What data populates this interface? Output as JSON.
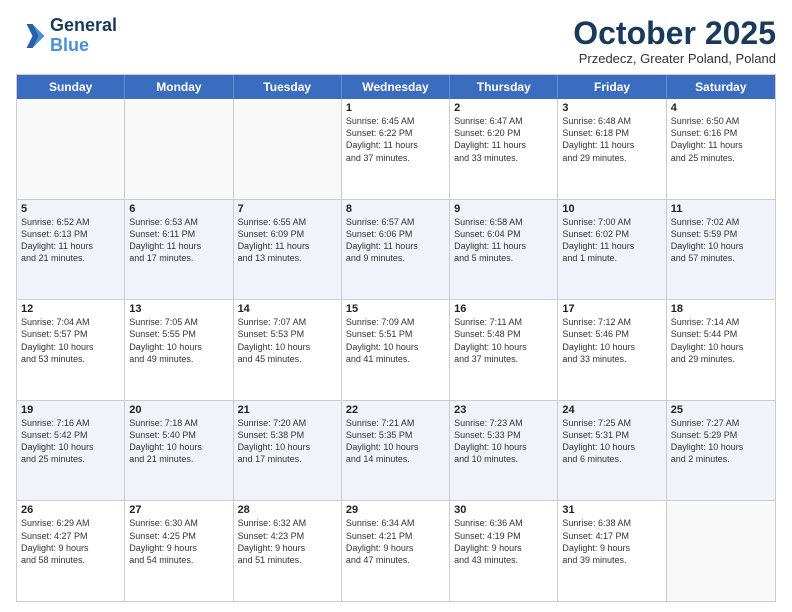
{
  "logo": {
    "line1": "General",
    "line2": "Blue"
  },
  "title": "October 2025",
  "subtitle": "Przedecz, Greater Poland, Poland",
  "header_days": [
    "Sunday",
    "Monday",
    "Tuesday",
    "Wednesday",
    "Thursday",
    "Friday",
    "Saturday"
  ],
  "weeks": [
    [
      {
        "day": "",
        "info": ""
      },
      {
        "day": "",
        "info": ""
      },
      {
        "day": "",
        "info": ""
      },
      {
        "day": "1",
        "info": "Sunrise: 6:45 AM\nSunset: 6:22 PM\nDaylight: 11 hours\nand 37 minutes."
      },
      {
        "day": "2",
        "info": "Sunrise: 6:47 AM\nSunset: 6:20 PM\nDaylight: 11 hours\nand 33 minutes."
      },
      {
        "day": "3",
        "info": "Sunrise: 6:48 AM\nSunset: 6:18 PM\nDaylight: 11 hours\nand 29 minutes."
      },
      {
        "day": "4",
        "info": "Sunrise: 6:50 AM\nSunset: 6:16 PM\nDaylight: 11 hours\nand 25 minutes."
      }
    ],
    [
      {
        "day": "5",
        "info": "Sunrise: 6:52 AM\nSunset: 6:13 PM\nDaylight: 11 hours\nand 21 minutes."
      },
      {
        "day": "6",
        "info": "Sunrise: 6:53 AM\nSunset: 6:11 PM\nDaylight: 11 hours\nand 17 minutes."
      },
      {
        "day": "7",
        "info": "Sunrise: 6:55 AM\nSunset: 6:09 PM\nDaylight: 11 hours\nand 13 minutes."
      },
      {
        "day": "8",
        "info": "Sunrise: 6:57 AM\nSunset: 6:06 PM\nDaylight: 11 hours\nand 9 minutes."
      },
      {
        "day": "9",
        "info": "Sunrise: 6:58 AM\nSunset: 6:04 PM\nDaylight: 11 hours\nand 5 minutes."
      },
      {
        "day": "10",
        "info": "Sunrise: 7:00 AM\nSunset: 6:02 PM\nDaylight: 11 hours\nand 1 minute."
      },
      {
        "day": "11",
        "info": "Sunrise: 7:02 AM\nSunset: 5:59 PM\nDaylight: 10 hours\nand 57 minutes."
      }
    ],
    [
      {
        "day": "12",
        "info": "Sunrise: 7:04 AM\nSunset: 5:57 PM\nDaylight: 10 hours\nand 53 minutes."
      },
      {
        "day": "13",
        "info": "Sunrise: 7:05 AM\nSunset: 5:55 PM\nDaylight: 10 hours\nand 49 minutes."
      },
      {
        "day": "14",
        "info": "Sunrise: 7:07 AM\nSunset: 5:53 PM\nDaylight: 10 hours\nand 45 minutes."
      },
      {
        "day": "15",
        "info": "Sunrise: 7:09 AM\nSunset: 5:51 PM\nDaylight: 10 hours\nand 41 minutes."
      },
      {
        "day": "16",
        "info": "Sunrise: 7:11 AM\nSunset: 5:48 PM\nDaylight: 10 hours\nand 37 minutes."
      },
      {
        "day": "17",
        "info": "Sunrise: 7:12 AM\nSunset: 5:46 PM\nDaylight: 10 hours\nand 33 minutes."
      },
      {
        "day": "18",
        "info": "Sunrise: 7:14 AM\nSunset: 5:44 PM\nDaylight: 10 hours\nand 29 minutes."
      }
    ],
    [
      {
        "day": "19",
        "info": "Sunrise: 7:16 AM\nSunset: 5:42 PM\nDaylight: 10 hours\nand 25 minutes."
      },
      {
        "day": "20",
        "info": "Sunrise: 7:18 AM\nSunset: 5:40 PM\nDaylight: 10 hours\nand 21 minutes."
      },
      {
        "day": "21",
        "info": "Sunrise: 7:20 AM\nSunset: 5:38 PM\nDaylight: 10 hours\nand 17 minutes."
      },
      {
        "day": "22",
        "info": "Sunrise: 7:21 AM\nSunset: 5:35 PM\nDaylight: 10 hours\nand 14 minutes."
      },
      {
        "day": "23",
        "info": "Sunrise: 7:23 AM\nSunset: 5:33 PM\nDaylight: 10 hours\nand 10 minutes."
      },
      {
        "day": "24",
        "info": "Sunrise: 7:25 AM\nSunset: 5:31 PM\nDaylight: 10 hours\nand 6 minutes."
      },
      {
        "day": "25",
        "info": "Sunrise: 7:27 AM\nSunset: 5:29 PM\nDaylight: 10 hours\nand 2 minutes."
      }
    ],
    [
      {
        "day": "26",
        "info": "Sunrise: 6:29 AM\nSunset: 4:27 PM\nDaylight: 9 hours\nand 58 minutes."
      },
      {
        "day": "27",
        "info": "Sunrise: 6:30 AM\nSunset: 4:25 PM\nDaylight: 9 hours\nand 54 minutes."
      },
      {
        "day": "28",
        "info": "Sunrise: 6:32 AM\nSunset: 4:23 PM\nDaylight: 9 hours\nand 51 minutes."
      },
      {
        "day": "29",
        "info": "Sunrise: 6:34 AM\nSunset: 4:21 PM\nDaylight: 9 hours\nand 47 minutes."
      },
      {
        "day": "30",
        "info": "Sunrise: 6:36 AM\nSunset: 4:19 PM\nDaylight: 9 hours\nand 43 minutes."
      },
      {
        "day": "31",
        "info": "Sunrise: 6:38 AM\nSunset: 4:17 PM\nDaylight: 9 hours\nand 39 minutes."
      },
      {
        "day": "",
        "info": ""
      }
    ]
  ]
}
